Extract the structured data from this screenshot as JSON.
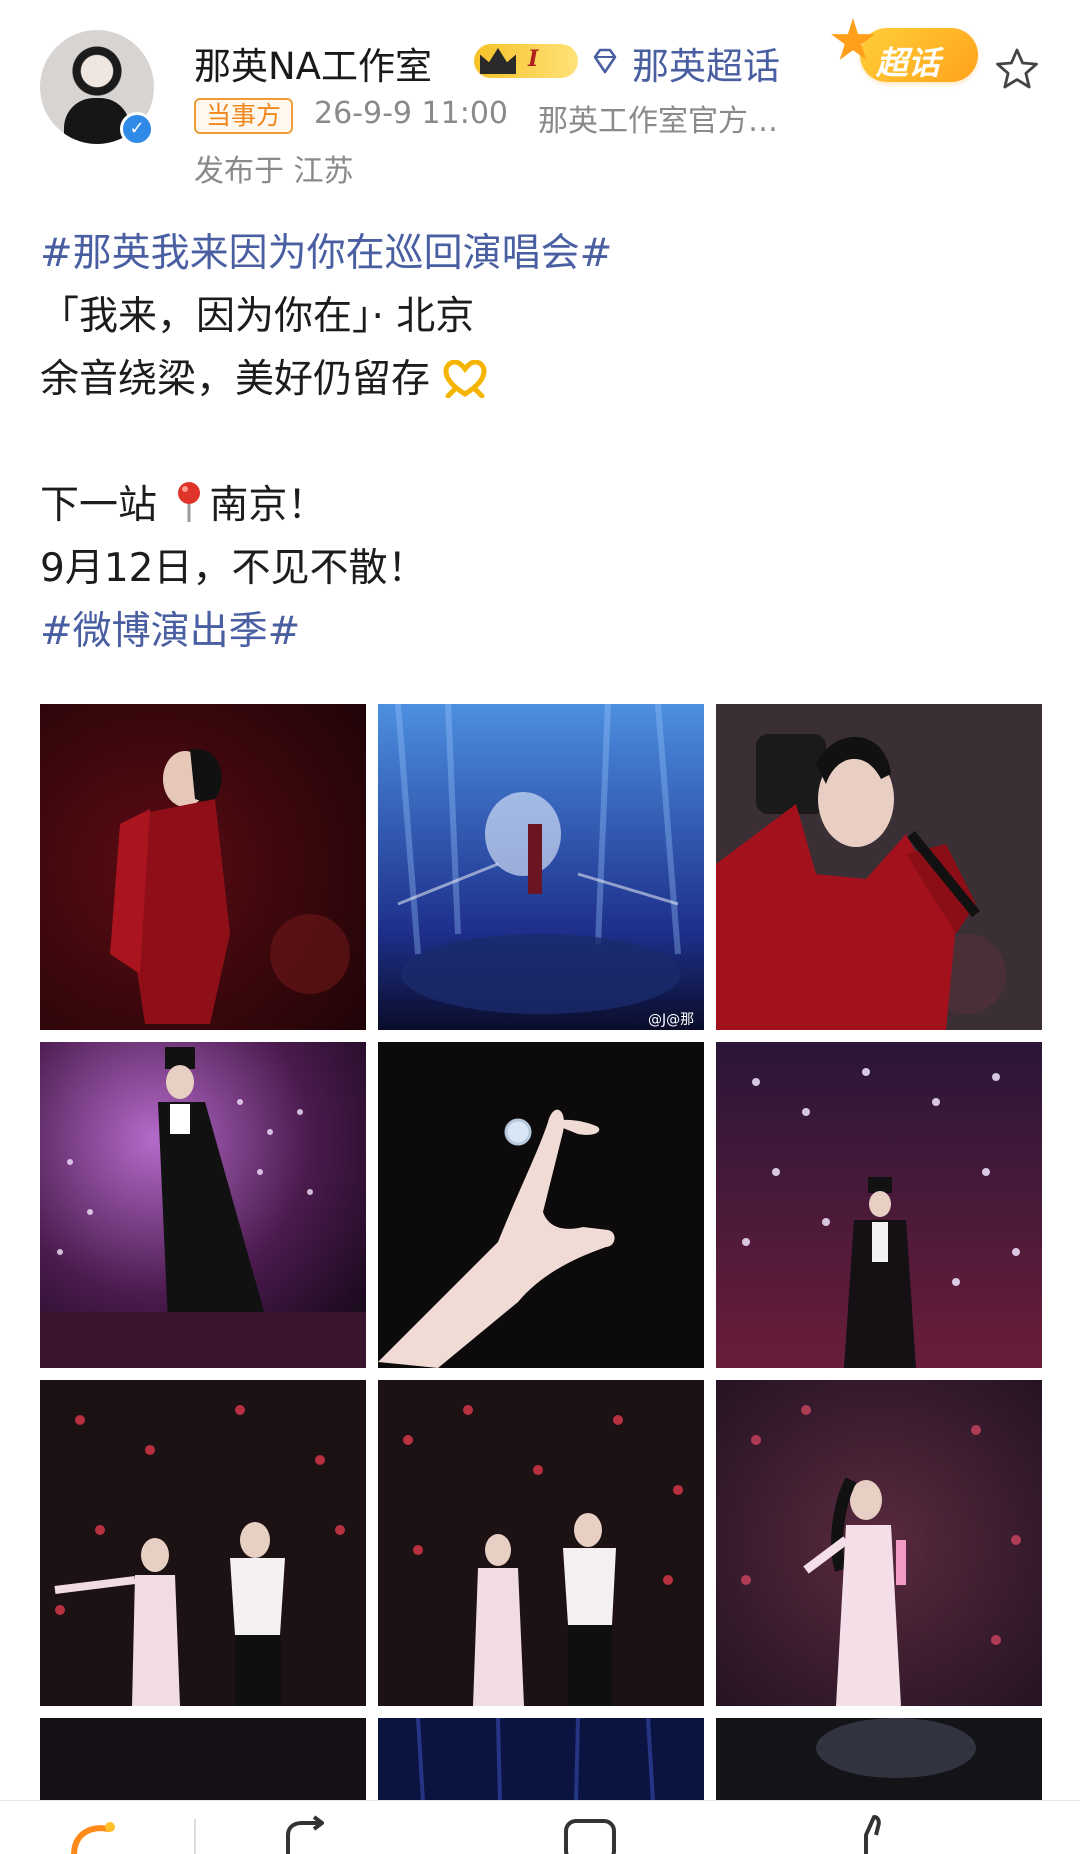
{
  "header": {
    "user_name": "那英NA工作室",
    "member_level": "I",
    "topic_link": "那英超话",
    "supertopic_badge": "超话",
    "tag": "当事方",
    "time": "26-9-9 11:00",
    "source": "那英工作室官方…",
    "location": "发布于 江苏"
  },
  "post": {
    "hashtag1": "#那英我来因为你在巡回演唱会#",
    "line2": "「我来，因为你在」· 北京",
    "line3": "余音绕梁，美好仍留存",
    "line5a": "下一站",
    "line5b": "南京！",
    "line6": "9月12日，不见不散！",
    "hashtag2": "#微博演出季#"
  },
  "photos": {
    "watermark": "@J@那"
  },
  "colors": {
    "link": "#4a5fa2",
    "tag": "#f0871d",
    "gold": "#f5c227",
    "verified": "#2e8ae6"
  },
  "icons": [
    "verified-icon",
    "crown-icon",
    "gem-icon",
    "favorite-star-icon",
    "heart-hands-icon",
    "location-pin-icon",
    "forward-icon",
    "comment-icon",
    "like-icon"
  ]
}
